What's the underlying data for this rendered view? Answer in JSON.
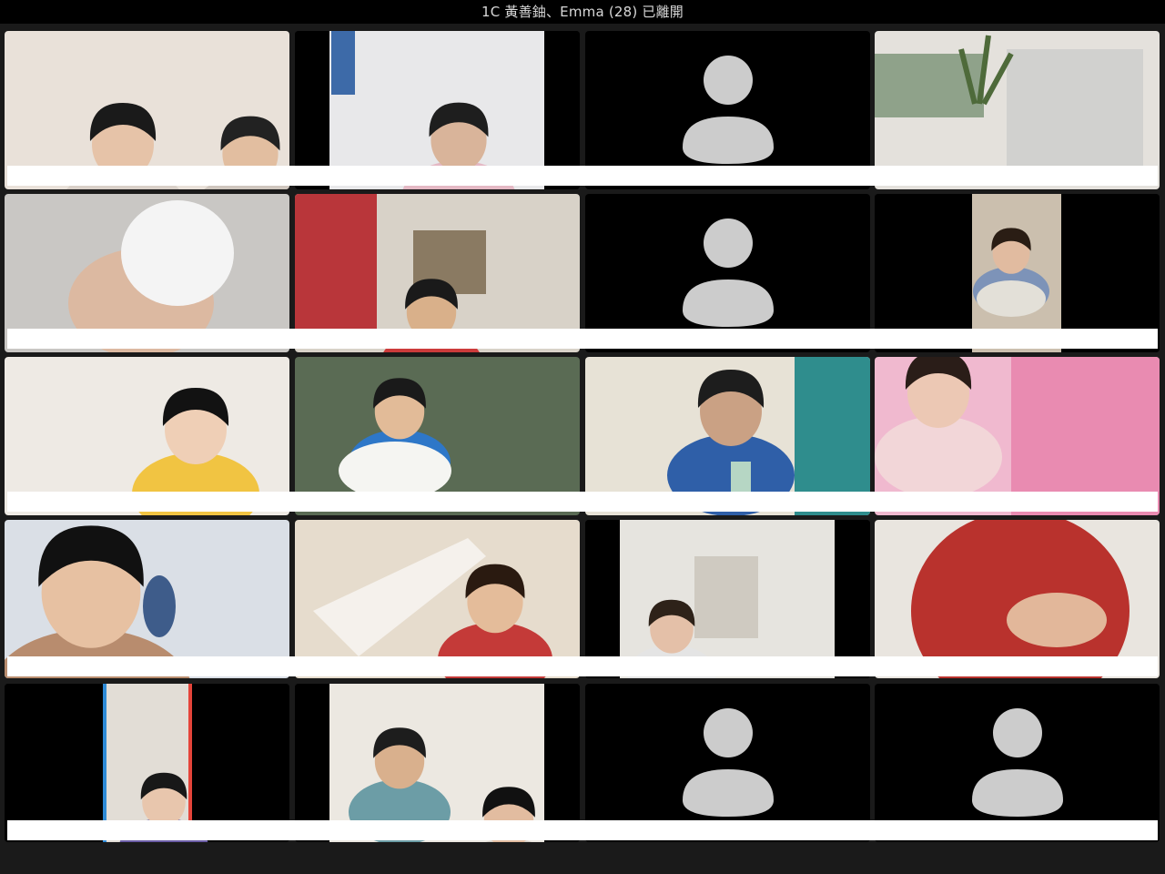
{
  "window": {
    "title": "1C 黃善鈾、Emma (28) 已離開"
  },
  "gallery": {
    "columns": 4,
    "rows": 5,
    "tiles": [
      {
        "video": "photo",
        "scene": "two-boys-at-desk"
      },
      {
        "video": "photo",
        "scene": "child-bending-in-room"
      },
      {
        "video": "off",
        "icon": "person-silhouette-icon"
      },
      {
        "video": "photo",
        "scene": "window-with-plant"
      },
      {
        "video": "photo",
        "scene": "hand-holding-white-tiger-dough"
      },
      {
        "video": "photo",
        "scene": "child-in-bright-room"
      },
      {
        "video": "off",
        "icon": "person-silhouette-icon"
      },
      {
        "video": "photo",
        "scene": "girl-with-bowl-portrait"
      },
      {
        "video": "photo",
        "scene": "girl-yellow-shirt"
      },
      {
        "video": "photo",
        "scene": "boy-with-plate-of-dumplings"
      },
      {
        "video": "photo",
        "scene": "boy-blue-shirt-with-bottle"
      },
      {
        "video": "photo",
        "scene": "girl-pink-poster-background"
      },
      {
        "video": "photo",
        "scene": "boy-with-headphones"
      },
      {
        "video": "photo",
        "scene": "boy-holding-white-tile"
      },
      {
        "video": "photo",
        "scene": "girl-with-glasses-portrait"
      },
      {
        "video": "photo",
        "scene": "child-red-patterned-shirt"
      },
      {
        "video": "photo",
        "scene": "girl-rainbow-frame-portrait"
      },
      {
        "video": "photo",
        "scene": "boy-sitting-at-table"
      },
      {
        "video": "off",
        "icon": "person-silhouette-icon"
      },
      {
        "video": "off",
        "icon": "person-silhouette-icon"
      }
    ]
  },
  "colors": {
    "background": "#1a1a1a",
    "topbar": "#000000",
    "avatar": "#cccccc",
    "redaction": "#ffffff"
  }
}
